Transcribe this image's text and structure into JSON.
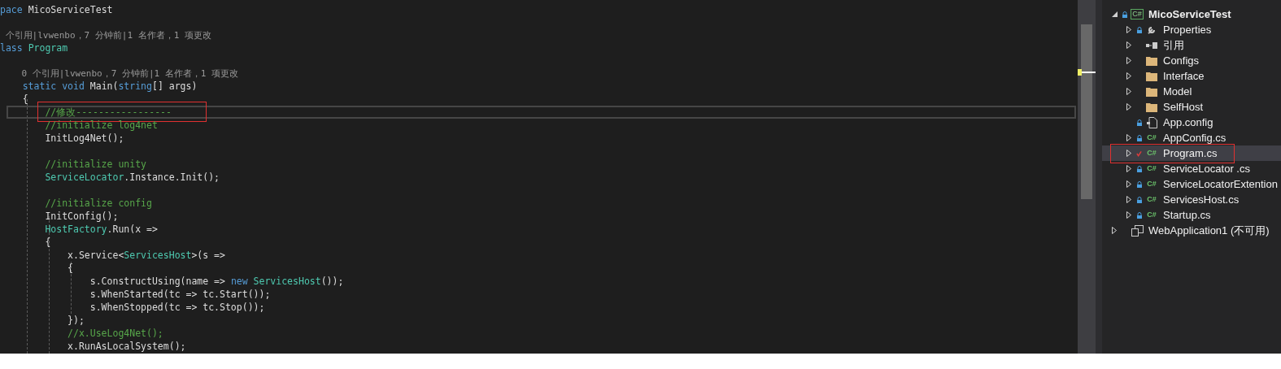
{
  "editor": {
    "lines": [
      {
        "kind": "code",
        "current": false,
        "annotated": false,
        "tokens": [
          {
            "kind": "keyword",
            "text": "pace"
          },
          {
            "kind": "plain",
            "text": " MicoServiceTest"
          }
        ]
      },
      {
        "kind": "blank",
        "current": false,
        "annotated": false
      },
      {
        "kind": "lens",
        "current": false,
        "annotated": false,
        "tokens": [
          {
            "kind": "lens",
            "text": " 个引用|lvwenbo，7 分钟前|1 名作者，1 项更改"
          }
        ]
      },
      {
        "kind": "code",
        "current": false,
        "annotated": false,
        "tokens": [
          {
            "kind": "keyword",
            "text": "lass"
          },
          {
            "kind": "type",
            "text": " Program"
          }
        ]
      },
      {
        "kind": "blank",
        "current": false,
        "annotated": false
      },
      {
        "kind": "lens",
        "current": false,
        "annotated": false,
        "tokens": [
          {
            "kind": "lens",
            "text": "    0 个引用|lvwenbo，7 分钟前|1 名作者，1 项更改"
          }
        ]
      },
      {
        "kind": "code",
        "current": false,
        "annotated": false,
        "tokens": [
          {
            "kind": "keyword",
            "text": "    static void"
          },
          {
            "kind": "plain",
            "text": " Main("
          },
          {
            "kind": "keyword",
            "text": "string"
          },
          {
            "kind": "plain",
            "text": "[] args)"
          }
        ]
      },
      {
        "kind": "code",
        "current": false,
        "annotated": false,
        "tokens": [
          {
            "kind": "plain",
            "text": "    {"
          }
        ]
      },
      {
        "kind": "code",
        "current": true,
        "annotated": true,
        "tokens": [
          {
            "kind": "comment",
            "text": "        //修改-----------------"
          }
        ]
      },
      {
        "kind": "code",
        "current": false,
        "annotated": false,
        "tokens": [
          {
            "kind": "comment",
            "text": "        //initialize log4net"
          }
        ]
      },
      {
        "kind": "code",
        "current": false,
        "annotated": false,
        "tokens": [
          {
            "kind": "plain",
            "text": "        InitLog4Net();"
          }
        ]
      },
      {
        "kind": "blank",
        "current": false,
        "annotated": false
      },
      {
        "kind": "code",
        "current": false,
        "annotated": false,
        "tokens": [
          {
            "kind": "comment",
            "text": "        //initialize unity"
          }
        ]
      },
      {
        "kind": "code",
        "current": false,
        "annotated": false,
        "tokens": [
          {
            "kind": "type",
            "text": "        ServiceLocator"
          },
          {
            "kind": "plain",
            "text": ".Instance.Init();"
          }
        ]
      },
      {
        "kind": "blank",
        "current": false,
        "annotated": false
      },
      {
        "kind": "code",
        "current": false,
        "annotated": false,
        "tokens": [
          {
            "kind": "comment",
            "text": "        //initialize config"
          }
        ]
      },
      {
        "kind": "code",
        "current": false,
        "annotated": false,
        "tokens": [
          {
            "kind": "plain",
            "text": "        InitConfig();"
          }
        ]
      },
      {
        "kind": "code",
        "current": false,
        "annotated": false,
        "tokens": [
          {
            "kind": "type",
            "text": "        HostFactory"
          },
          {
            "kind": "plain",
            "text": ".Run(x =>"
          }
        ]
      },
      {
        "kind": "code",
        "current": false,
        "annotated": false,
        "tokens": [
          {
            "kind": "plain",
            "text": "        {"
          }
        ]
      },
      {
        "kind": "code",
        "current": false,
        "annotated": false,
        "tokens": [
          {
            "kind": "plain",
            "text": "            x.Service<"
          },
          {
            "kind": "type",
            "text": "ServicesHost"
          },
          {
            "kind": "plain",
            "text": ">(s =>"
          }
        ]
      },
      {
        "kind": "code",
        "current": false,
        "annotated": false,
        "tokens": [
          {
            "kind": "plain",
            "text": "            {"
          }
        ]
      },
      {
        "kind": "code",
        "current": false,
        "annotated": false,
        "tokens": [
          {
            "kind": "plain",
            "text": "                s.ConstructUsing(name => "
          },
          {
            "kind": "keyword",
            "text": "new"
          },
          {
            "kind": "type",
            "text": " ServicesHost"
          },
          {
            "kind": "plain",
            "text": "());"
          }
        ]
      },
      {
        "kind": "code",
        "current": false,
        "annotated": false,
        "tokens": [
          {
            "kind": "plain",
            "text": "                s.WhenStarted(tc => tc.Start());"
          }
        ]
      },
      {
        "kind": "code",
        "current": false,
        "annotated": false,
        "tokens": [
          {
            "kind": "plain",
            "text": "                s.WhenStopped(tc => tc.Stop());"
          }
        ]
      },
      {
        "kind": "code",
        "current": false,
        "annotated": false,
        "tokens": [
          {
            "kind": "plain",
            "text": "            });"
          }
        ]
      },
      {
        "kind": "code",
        "current": false,
        "annotated": false,
        "tokens": [
          {
            "kind": "comment",
            "text": "            //x.UseLog4Net();"
          }
        ]
      },
      {
        "kind": "code",
        "current": false,
        "annotated": false,
        "tokens": [
          {
            "kind": "plain",
            "text": "            x.RunAsLocalSystem();"
          }
        ]
      }
    ]
  },
  "solution_explorer": {
    "items": [
      {
        "kind": "project",
        "label": "MicoServiceTest",
        "badge": "C#",
        "locked": true,
        "edited": false,
        "expandable": true,
        "expanded": true,
        "selected": false,
        "annotated": false,
        "children": [
          {
            "kind": "properties",
            "label": "Properties",
            "locked": true,
            "edited": false,
            "expandable": true,
            "expanded": false,
            "selected": false,
            "annotated": false
          },
          {
            "kind": "references",
            "label": "引用",
            "locked": false,
            "edited": false,
            "expandable": true,
            "expanded": false,
            "selected": false,
            "annotated": false
          },
          {
            "kind": "folder",
            "label": "Configs",
            "locked": false,
            "edited": false,
            "expandable": true,
            "expanded": false,
            "selected": false,
            "annotated": false
          },
          {
            "kind": "folder",
            "label": "Interface",
            "locked": false,
            "edited": false,
            "expandable": true,
            "expanded": false,
            "selected": false,
            "annotated": false
          },
          {
            "kind": "folder",
            "label": "Model",
            "locked": false,
            "edited": false,
            "expandable": true,
            "expanded": false,
            "selected": false,
            "annotated": false
          },
          {
            "kind": "folder",
            "label": "SelfHost",
            "locked": false,
            "edited": false,
            "expandable": true,
            "expanded": false,
            "selected": false,
            "annotated": false
          },
          {
            "kind": "config",
            "label": "App.config",
            "locked": true,
            "edited": false,
            "expandable": false,
            "expanded": false,
            "selected": false,
            "annotated": false
          },
          {
            "kind": "cs",
            "label": "AppConfig.cs",
            "badge": "C#",
            "locked": true,
            "edited": false,
            "expandable": true,
            "expanded": false,
            "selected": false,
            "annotated": false
          },
          {
            "kind": "cs",
            "label": "Program.cs",
            "badge": "C#",
            "locked": false,
            "edited": true,
            "expandable": true,
            "expanded": false,
            "selected": true,
            "annotated": true
          },
          {
            "kind": "cs",
            "label": "ServiceLocator .cs",
            "badge": "C#",
            "locked": true,
            "edited": false,
            "expandable": true,
            "expanded": false,
            "selected": false,
            "annotated": false
          },
          {
            "kind": "cs",
            "label": "ServiceLocatorExtention",
            "badge": "C#",
            "locked": true,
            "edited": false,
            "expandable": true,
            "expanded": false,
            "selected": false,
            "annotated": false
          },
          {
            "kind": "cs",
            "label": "ServicesHost.cs",
            "badge": "C#",
            "locked": true,
            "edited": false,
            "expandable": true,
            "expanded": false,
            "selected": false,
            "annotated": false
          },
          {
            "kind": "cs",
            "label": "Startup.cs",
            "badge": "C#",
            "locked": true,
            "edited": false,
            "expandable": true,
            "expanded": false,
            "selected": false,
            "annotated": false
          }
        ]
      },
      {
        "kind": "unavailable_project",
        "label": "WebApplication1 (不可用)",
        "locked": false,
        "edited": false,
        "expandable": true,
        "expanded": false,
        "selected": false,
        "annotated": false
      }
    ]
  }
}
